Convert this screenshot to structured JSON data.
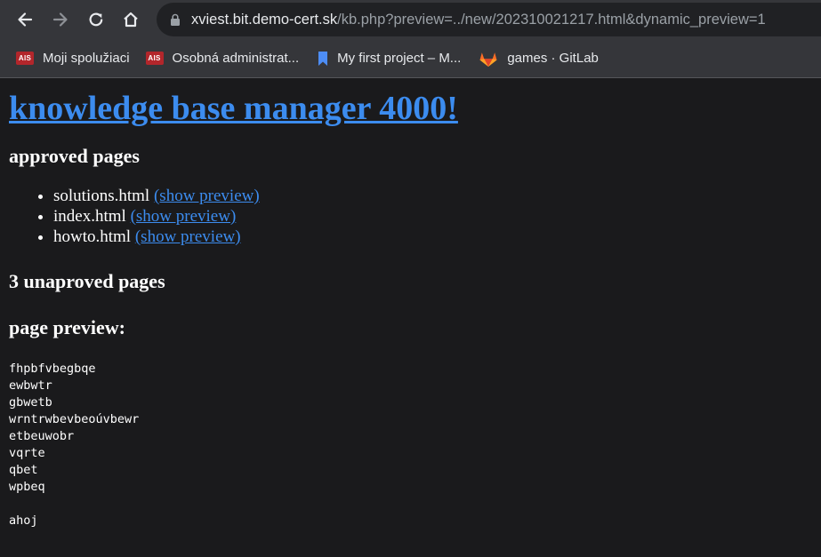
{
  "browser": {
    "url_host": "xviest.bit.demo-cert.sk",
    "url_rest": "/kb.php?preview=../new/202310021217.html&dynamic_preview=1",
    "bookmarks": [
      {
        "label": "Moji spolužiaci",
        "icon": "ais-icon"
      },
      {
        "label": "Osobná administrat...",
        "icon": "ais-icon"
      },
      {
        "label": "My first project – M...",
        "icon": "bookmark-icon"
      },
      {
        "label": "games · GitLab",
        "icon": "gitlab-icon"
      }
    ],
    "ais_badge": "AIS"
  },
  "page": {
    "title": "knowledge base manager 4000!",
    "approved_heading": "approved pages",
    "approved": [
      {
        "name": "solutions.html",
        "link": "(show preview)"
      },
      {
        "name": "index.html",
        "link": "(show preview)"
      },
      {
        "name": "howto.html",
        "link": "(show preview)"
      }
    ],
    "unapproved_heading": "3 unaproved pages",
    "preview_heading": "page preview:",
    "preview_text": "fhpbfvbegbqe\newbwtr\ngbwetb\nwrntrwbevbeoúvbewr\netbeuwobr\nvqrte\nqbet\nwpbeq\n\nahoj"
  },
  "colors": {
    "link": "#3c8cef",
    "background": "#1a1a1c",
    "chrome": "#35363a",
    "ais_red": "#b3262b",
    "gitlab_orange": "#e24329"
  }
}
